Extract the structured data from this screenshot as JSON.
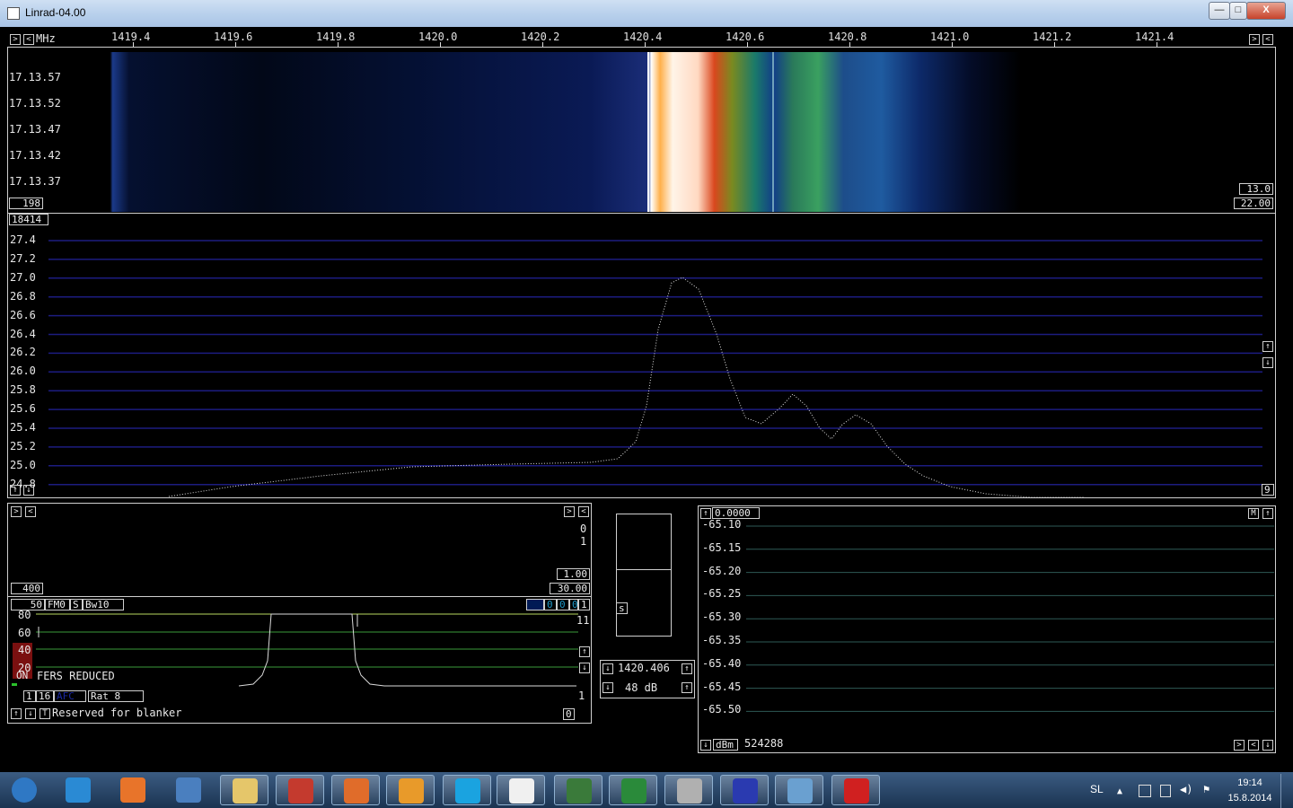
{
  "window": {
    "title": "Linrad-04.00",
    "minimize": "—",
    "maximize": "□",
    "close": "X"
  },
  "freq_axis": {
    "unit": "MHz",
    "ticks": [
      "1419.4",
      "1419.6",
      "1419.8",
      "1420.0",
      "1420.2",
      "1420.4",
      "1420.6",
      "1420.8",
      "1421.0",
      "1421.2",
      "1421.4"
    ]
  },
  "waterfall": {
    "times": [
      "17.13.57",
      "17.13.52",
      "17.13.47",
      "17.13.42",
      "17.13.37"
    ],
    "left_box": "198",
    "right_top": "13.0",
    "right_bottom": "22.00"
  },
  "spectrum": {
    "avg_box": "18414",
    "y_labels": [
      "27.4",
      "27.2",
      "27.0",
      "26.8",
      "26.6",
      "26.4",
      "26.2",
      "26.0",
      "25.8",
      "25.6",
      "25.4",
      "25.2",
      "25.0",
      "24.8"
    ],
    "right_box": "9"
  },
  "baseband": {
    "right_labels": [
      "0",
      "1"
    ],
    "box_top": "1.00",
    "box_bottom": "30.00",
    "left_box": "400",
    "controls": [
      "50",
      "FM0",
      "S",
      "Bw10"
    ],
    "right_controls": [
      "0",
      "0",
      "0",
      "1"
    ],
    "scale": [
      "80",
      "60",
      "40",
      "20"
    ],
    "scale_right_top": "11",
    "scale_right_bottom": "1",
    "on_label": "ON",
    "fers_label": "FERS REDUCED",
    "row_a": [
      "1",
      "16",
      "AFC",
      "Rat  8"
    ],
    "blanker_text": "Reserved for blanker",
    "blanker_box": "0",
    "t_label": "T"
  },
  "smeter": {
    "label": "s",
    "freq": "1420.406",
    "gain": "48 dB"
  },
  "power": {
    "top_box": "0.0000",
    "m_label": "M",
    "y_labels": [
      "-65.10",
      "-65.15",
      "-65.20",
      "-65.25",
      "-65.30",
      "-65.35",
      "-65.40",
      "-65.45",
      "-65.50"
    ],
    "unit": "dBm",
    "count": "524288"
  },
  "tray": {
    "lang": "SL",
    "time": "19:14",
    "date": "15.8.2014"
  },
  "taskbar_apps": [
    {
      "name": "start-orb",
      "color": "#2f78c4"
    },
    {
      "name": "internet-explorer-icon",
      "color": "#2a8ad4"
    },
    {
      "name": "firefox-icon",
      "color": "#e8742a"
    },
    {
      "name": "thunderbird-icon",
      "color": "#4a7fbf"
    },
    {
      "name": "file-explorer-icon",
      "color": "#e5c66a"
    },
    {
      "name": "library-books-icon",
      "color": "#c43a2e"
    },
    {
      "name": "orange-app-icon",
      "color": "#e06c2a"
    },
    {
      "name": "media-player-icon",
      "color": "#e89a2a"
    },
    {
      "name": "skype-icon",
      "color": "#1aa3e0"
    },
    {
      "name": "linrad-penguin-icon",
      "color": "#f0f0f0"
    },
    {
      "name": "radio-app-icon",
      "color": "#3a7a3a"
    },
    {
      "name": "excel-icon",
      "color": "#2a8a3a"
    },
    {
      "name": "rocket-app-icon",
      "color": "#b0b0b0"
    },
    {
      "name": "satellite-dish-icon",
      "color": "#2a3ab0"
    },
    {
      "name": "photo-viewer-icon",
      "color": "#6aa0d0"
    },
    {
      "name": "red-app-icon",
      "color": "#d02020"
    }
  ]
}
